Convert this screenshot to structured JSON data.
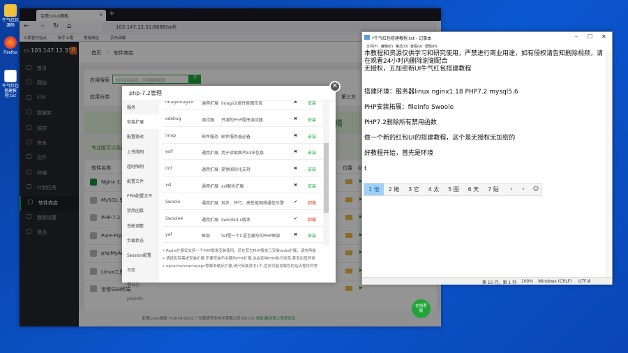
{
  "desktop": {
    "icons": [
      {
        "label": "牛气红包源码"
      },
      {
        "label": "Firefox"
      },
      {
        "label": "牛气红包搭建教程.txt"
      }
    ]
  },
  "browser": {
    "tab_title": "宝塔Linux面板",
    "new_tab": "+",
    "url": "103.147.12.31:8888/soft",
    "bookmarks": [
      "火狐官方站点",
      "新手上路",
      "常用网址",
      "京东商城"
    ]
  },
  "panel": {
    "server_ip": "103.147.12.31",
    "badge": "0",
    "sidebar": [
      {
        "label": "首页"
      },
      {
        "label": "网站"
      },
      {
        "label": "FTP"
      },
      {
        "label": "数据库"
      },
      {
        "label": "监控"
      },
      {
        "label": "安全"
      },
      {
        "label": "文件"
      },
      {
        "label": "终端"
      },
      {
        "label": "计划任务"
      },
      {
        "label": "软件商店",
        "active": true
      },
      {
        "label": "面板设置"
      },
      {
        "label": "退出"
      }
    ],
    "breadcrumb": [
      "首页",
      "软件商店"
    ],
    "search_label": "应用搜索",
    "search_placeholder": "支持应用名称、字段模糊搜索",
    "category_label": "应用分类",
    "category_right": "第三方",
    "banner_left": "保",
    "banner_right": "精",
    "pro_text": "专业版可以免费",
    "table_header": [
      "软件名称",
      "位置",
      "状"
    ],
    "software": [
      "Nginx 1.18",
      "MySQL 5.6",
      "PHP-7.2",
      "Pure-Ftpd 1",
      "phpMyAdmin",
      "Linux工具箱",
      "宝塔SSH终端"
    ],
    "footer_text": "宝塔Linux面板 ©2014-2021 广东堡塔安全技术有限公司 (bt.cn)",
    "footer_link": "求助|建议请上宝塔论坛",
    "float_button": "在线客服",
    "accent": "#20a53a"
  },
  "modal": {
    "title": "php-7.2管理",
    "nav": [
      {
        "label": "服务"
      },
      {
        "label": "安装扩展",
        "active": true
      },
      {
        "label": "配置修改"
      },
      {
        "label": "上传限制"
      },
      {
        "label": "超时限制"
      },
      {
        "label": "配置文件"
      },
      {
        "label": "FPM配置文件"
      },
      {
        "label": "禁用函数"
      },
      {
        "label": "性能调整"
      },
      {
        "label": "负载状态"
      },
      {
        "label": "Session配置"
      },
      {
        "label": "日志"
      },
      {
        "label": "慢日志"
      },
      {
        "label": "phpinfo"
      }
    ],
    "extensions": [
      {
        "name": "imagemagick",
        "type": "通用扩展",
        "desc": "Imagick高性能图形库",
        "installed": false,
        "action": "安装"
      },
      {
        "name": "xdebug",
        "type": "调试器",
        "desc": "开源的PHP程序调试器",
        "installed": false,
        "action": "安装"
      },
      {
        "name": "imap",
        "type": "邮件服务",
        "desc": "邮件服务器必备",
        "installed": false,
        "action": "安装"
      },
      {
        "name": "exif",
        "type": "通用扩展",
        "desc": "用于读取图片EXIF信息",
        "installed": false,
        "action": "安装"
      },
      {
        "name": "intl",
        "type": "通用扩展",
        "desc": "提供国际化支持",
        "installed": false,
        "action": "安装"
      },
      {
        "name": "xsl",
        "type": "通用扩展",
        "desc": "xsl解析扩展",
        "installed": false,
        "action": "安装"
      },
      {
        "name": "Swoole",
        "type": "通用扩展",
        "desc": "异步、并行、高性能网络通信引擎",
        "installed": true,
        "action": "卸载"
      },
      {
        "name": "Swoole4",
        "type": "通用扩展",
        "desc": "swoole4.x版本",
        "installed": true,
        "action": "卸载"
      },
      {
        "name": "yaf",
        "type": "框架",
        "desc": "Yaf是一个C语言编写的PHP框架",
        "installed": false,
        "action": "安装"
      },
      {
        "name": "phalcon",
        "type": "框架",
        "desc": "phalcon是一个C语言编写的PHP框架",
        "installed": false,
        "action": "安装"
      },
      {
        "name": "mongodb",
        "type": "通用扩展",
        "desc": "Mongodb数据库连接驱动",
        "installed": false,
        "action": "安装"
      },
      {
        "name": "yac",
        "type": "缓存器",
        "desc": "高性能无锁共享内存Cache",
        "installed": false,
        "action": "安装"
      },
      {
        "name": "sg11",
        "type": "脚本加密",
        "desc": "php代码混淆加密",
        "installed": false,
        "action": "安装"
      }
    ],
    "notes": [
      "Redis扩展仅支持一个PHP版本安装使用，若在其它PHP版本已安装redis扩展，请勿再装",
      "请按实际需求安装扩展,不要安装不必要的PHP扩展,这会影响PHP执行效率,甚至出现异常",
      "opcache/xcache/apc等脚本缓存扩展,请只安装其中1个,否则可能导致您的站点程序异常"
    ],
    "colors": {
      "install": "#20a53a",
      "uninstall": "#e0301e"
    }
  },
  "notepad": {
    "title": "*牛气红包搭建教程.txt - 记事本",
    "menu": [
      "文件(F)",
      "编辑(E)",
      "格式(O)",
      "查看(V)",
      "帮助(H)"
    ],
    "lines": [
      "本教程和资源仅供学习和研究使用，严禁进行商业用途，如有侵权请告知删除视频，请",
      "在观看24小时内删除谢谢配合",
      "无授权，五加密新UI牛气红包搭建教程",
      "",
      "",
      "搭建环境：服务器linux  nginx1.18  PHP7.2  mysql5.6",
      "",
      "PHP安装拓展：fileinfo  Swoole",
      "",
      "PHP7.2删除所有禁用函数",
      "",
      "做一个新的红包UI的搭建教程，这个是无授权无加密的",
      "",
      "好教程开始，首先是环境",
      "",
      "t"
    ],
    "status": {
      "position": "第 15 行，第 1 列",
      "zoom": "100%",
      "eol": "Windows (CRLF)",
      "encoding": "UTF-8"
    }
  },
  "ime": {
    "candidates": [
      "1 他",
      "2 她",
      "3 它",
      "4 太",
      "5 图",
      "6 天",
      "7 贴"
    ],
    "selected": 0,
    "prev": "‹",
    "next": "›",
    "emoji": "☺"
  }
}
